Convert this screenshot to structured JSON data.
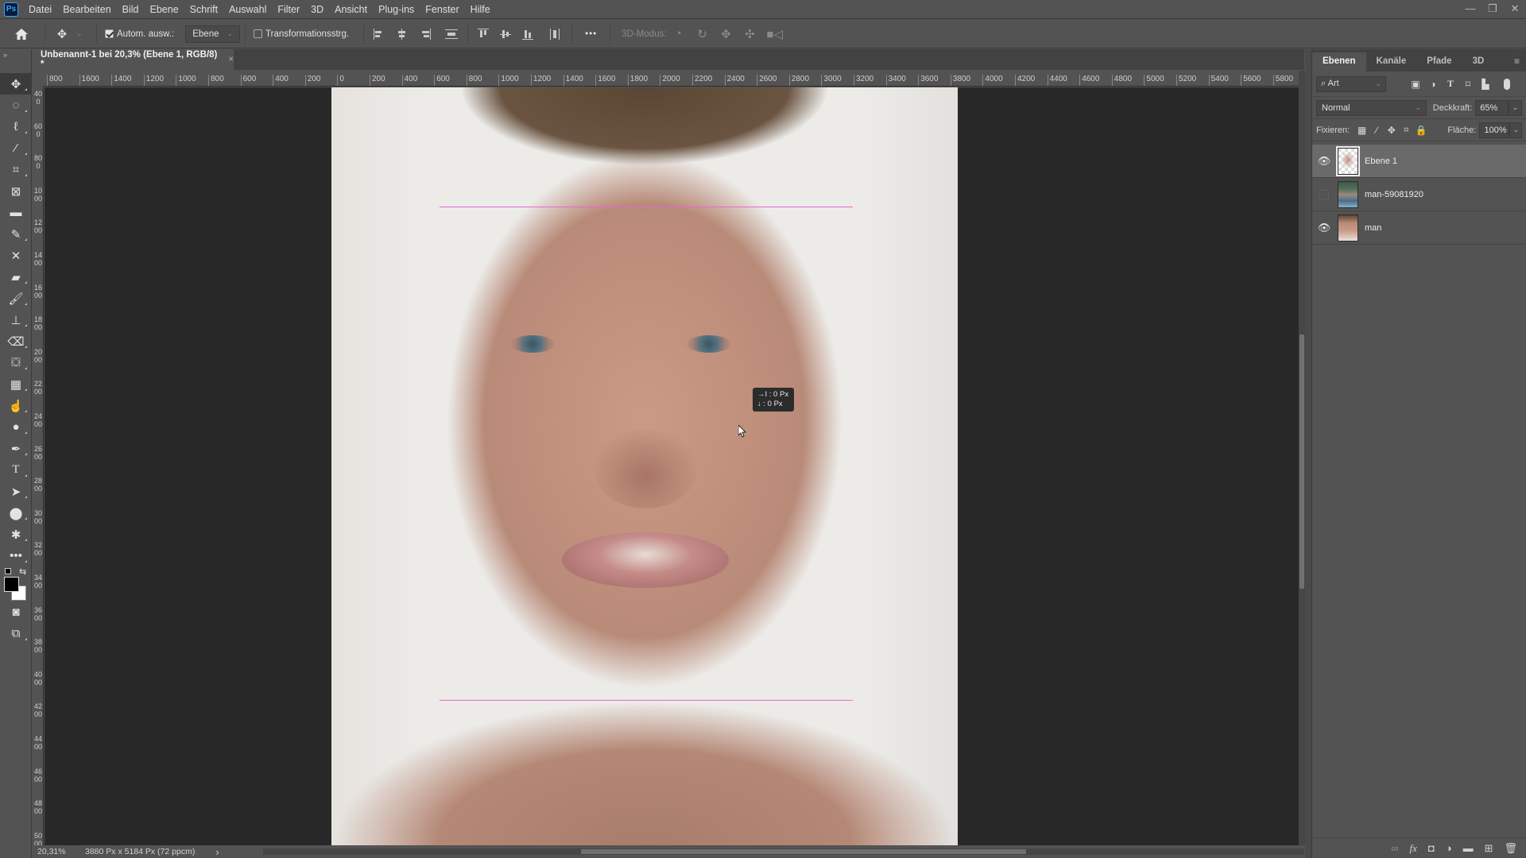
{
  "app": {
    "logo": "Ps"
  },
  "menu": [
    "Datei",
    "Bearbeiten",
    "Bild",
    "Ebene",
    "Schrift",
    "Auswahl",
    "Filter",
    "3D",
    "Ansicht",
    "Plug-ins",
    "Fenster",
    "Hilfe"
  ],
  "window_controls": {
    "minimize": "—",
    "restore": "❐",
    "close": "✕"
  },
  "options_bar": {
    "auto_select_label": "Autom. ausw.:",
    "auto_select_checked": true,
    "auto_select_target": "Ebene",
    "transform_controls_label": "Transformationsstrg.",
    "transform_controls_checked": false,
    "more_label": "•••",
    "mode_3d_label": "3D-Modus:"
  },
  "document_tab": {
    "title": "Unbenannt-1 bei 20,3% (Ebene 1, RGB/8) *",
    "close": "×"
  },
  "ruler_h": [
    "800",
    "1600",
    "1400",
    "1200",
    "1000",
    "800",
    "600",
    "400",
    "200",
    "0",
    "200",
    "400",
    "600",
    "800",
    "1000",
    "1200",
    "1400",
    "1600",
    "1800",
    "2000",
    "2200",
    "2400",
    "2600",
    "2800",
    "3000",
    "3200",
    "3400",
    "3600",
    "3800",
    "4000",
    "4200",
    "4400",
    "4600",
    "4800",
    "5000",
    "5200",
    "5400",
    "5600",
    "5800"
  ],
  "ruler_v": [
    "400",
    "600",
    "800",
    "1000",
    "1200",
    "1400",
    "1600",
    "1800",
    "2000",
    "2200",
    "2400",
    "2600",
    "2800",
    "3000",
    "3200",
    "3400",
    "3600",
    "3800",
    "4000",
    "4200",
    "4400",
    "4600",
    "4800",
    "5000"
  ],
  "tooltip": {
    "line1": "→I : 0 Px",
    "line2": "↓ : 0 Px"
  },
  "status": {
    "zoom": "20,31%",
    "doc_info": "3880 Px x 5184 Px (72 ppcm)",
    "arrow": "›"
  },
  "layers_panel": {
    "tabs": [
      {
        "label": "Ebenen",
        "active": true
      },
      {
        "label": "Kanäle",
        "active": false
      },
      {
        "label": "Pfade",
        "active": false
      },
      {
        "label": "3D",
        "active": false
      }
    ],
    "filter_kind": "Art",
    "blend_mode": "Normal",
    "opacity_label": "Deckkraft:",
    "opacity_value": "65%",
    "lock_label": "Fixieren:",
    "fill_label": "Fläche:",
    "fill_value": "100%",
    "layers": [
      {
        "name": "Ebene 1",
        "visible": true,
        "selected": true
      },
      {
        "name": "man-59081920",
        "visible": false,
        "selected": false
      },
      {
        "name": "man",
        "visible": true,
        "selected": false
      }
    ]
  }
}
